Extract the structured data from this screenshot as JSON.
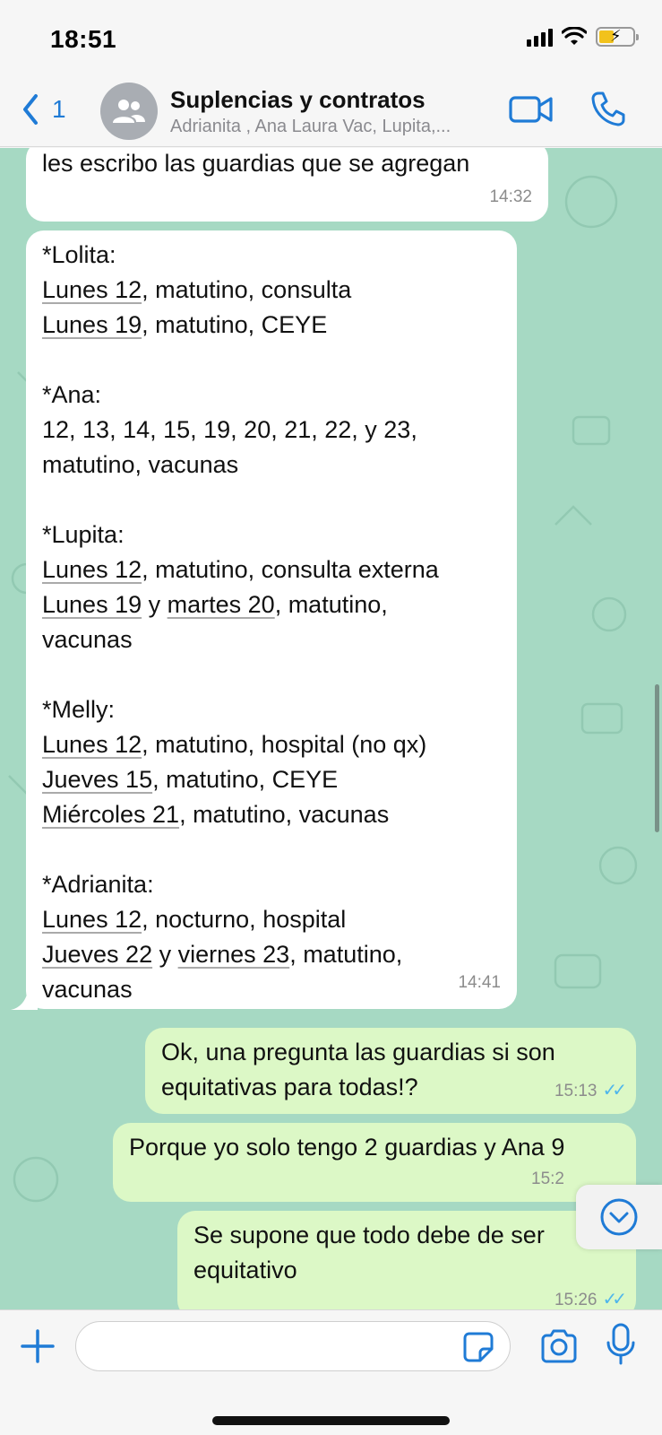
{
  "status_bar": {
    "time": "18:51",
    "icons": [
      "cellular-signal-icon",
      "wifi-icon",
      "battery-charging-icon"
    ]
  },
  "header": {
    "back_count": "1",
    "title": "Suplencias y contratos",
    "members": "Adrianita , Ana Laura Vac, Lupita,...",
    "icons": [
      "chevron-left-icon",
      "group-avatar-icon",
      "video-call-icon",
      "phone-icon"
    ]
  },
  "messages": [
    {
      "direction": "incoming",
      "lines": [
        "les escribo las guardias que se agregan"
      ],
      "time": "14:32"
    },
    {
      "direction": "incoming",
      "lines": [
        "*Lolita:",
        "Lunes 12, matutino, consulta",
        "Lunes 19, matutino, CEYE",
        "",
        "*Ana:",
        "12, 13, 14, 15, 19, 20, 21, 22, y 23,",
        "matutino, vacunas",
        "",
        "*Lupita:",
        "Lunes 12, matutino, consulta externa",
        "Lunes 19 y martes 20, matutino,",
        "vacunas",
        "",
        "*Melly:",
        "Lunes 12, matutino, hospital (no qx)",
        "Jueves 15, matutino, CEYE",
        "Miércoles 21, matutino, vacunas",
        "",
        "*Adrianita:",
        "Lunes 12, nocturno, hospital",
        "Jueves 22 y viernes 23, matutino,",
        "vacunas"
      ],
      "time": "14:41"
    },
    {
      "direction": "outgoing",
      "lines": [
        "Ok, una pregunta las guardias si son",
        "equitativas para todas!?"
      ],
      "time": "15:13",
      "status": "read"
    },
    {
      "direction": "outgoing",
      "lines": [
        "Porque yo solo tengo 2 guardias y Ana 9"
      ],
      "time": "15:2",
      "status": "read"
    },
    {
      "direction": "outgoing",
      "lines": [
        "Se supone que todo debe de ser",
        "equitativo"
      ],
      "time": "15:26",
      "status": "read"
    }
  ],
  "input": {
    "placeholder": "",
    "icons": [
      "plus-icon",
      "sticker-icon",
      "camera-icon",
      "microphone-icon"
    ]
  },
  "scroll_down_icon": "chevron-down-circle-icon",
  "colors": {
    "accent": "#1f7bd6",
    "chat_background": "#a6d9c3",
    "incoming_bubble": "#ffffff",
    "outgoing_bubble": "#dcf8c6",
    "read_ticks": "#4fb6ec"
  }
}
